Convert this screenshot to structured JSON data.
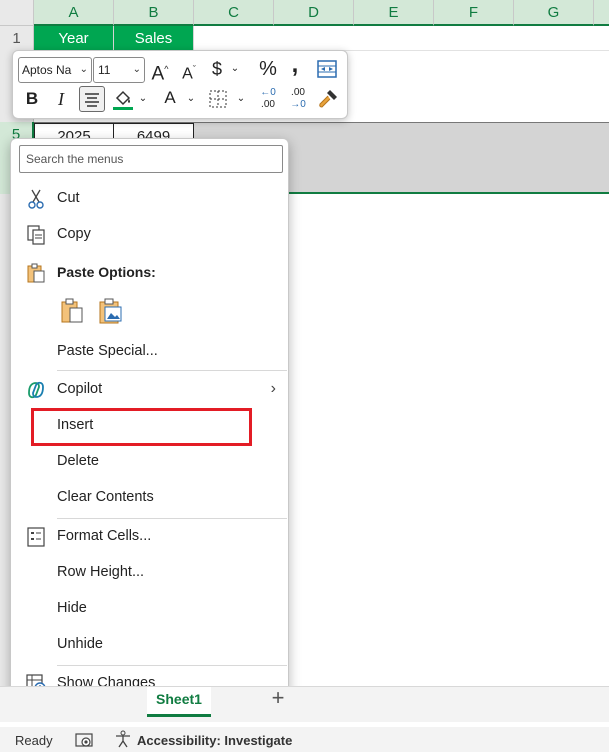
{
  "columns": [
    "A",
    "B",
    "C",
    "D",
    "E",
    "F",
    "G"
  ],
  "rows": [
    "1",
    "5"
  ],
  "cells": {
    "a1": "Year",
    "b1": "Sales",
    "a5": "2025",
    "b5": "6499"
  },
  "mini_toolbar": {
    "font_name": "Aptos Na",
    "font_size": "11",
    "increase_font": "A",
    "decrease_font": "A",
    "currency": "$",
    "percent": "%",
    "comma": ",",
    "bold": "B",
    "italic": "I",
    "font_color": "A",
    "inc_decimal_top": "←0",
    "inc_decimal_bottom": ".00",
    "dec_decimal_top": ".00",
    "dec_decimal_bottom": "→0"
  },
  "context_menu": {
    "search_placeholder": "Search the menus",
    "items": {
      "cut": "Cut",
      "copy": "Copy",
      "paste_options": "Paste Options:",
      "paste_special": "Paste Special...",
      "copilot": "Copilot",
      "insert": "Insert",
      "delete": "Delete",
      "clear_contents": "Clear Contents",
      "format_cells": "Format Cells...",
      "row_height": "Row Height...",
      "hide": "Hide",
      "unhide": "Unhide",
      "show_changes": "Show Changes"
    }
  },
  "sheet_tab": "Sheet1",
  "add_sheet": "+",
  "status_bar": {
    "ready": "Ready",
    "accessibility": "Accessibility: Investigate"
  },
  "colors": {
    "header_fill": "#00a651",
    "excel_green": "#107c41",
    "highlight_box": "#e31c25",
    "selection_band": "#d4d4d4"
  }
}
